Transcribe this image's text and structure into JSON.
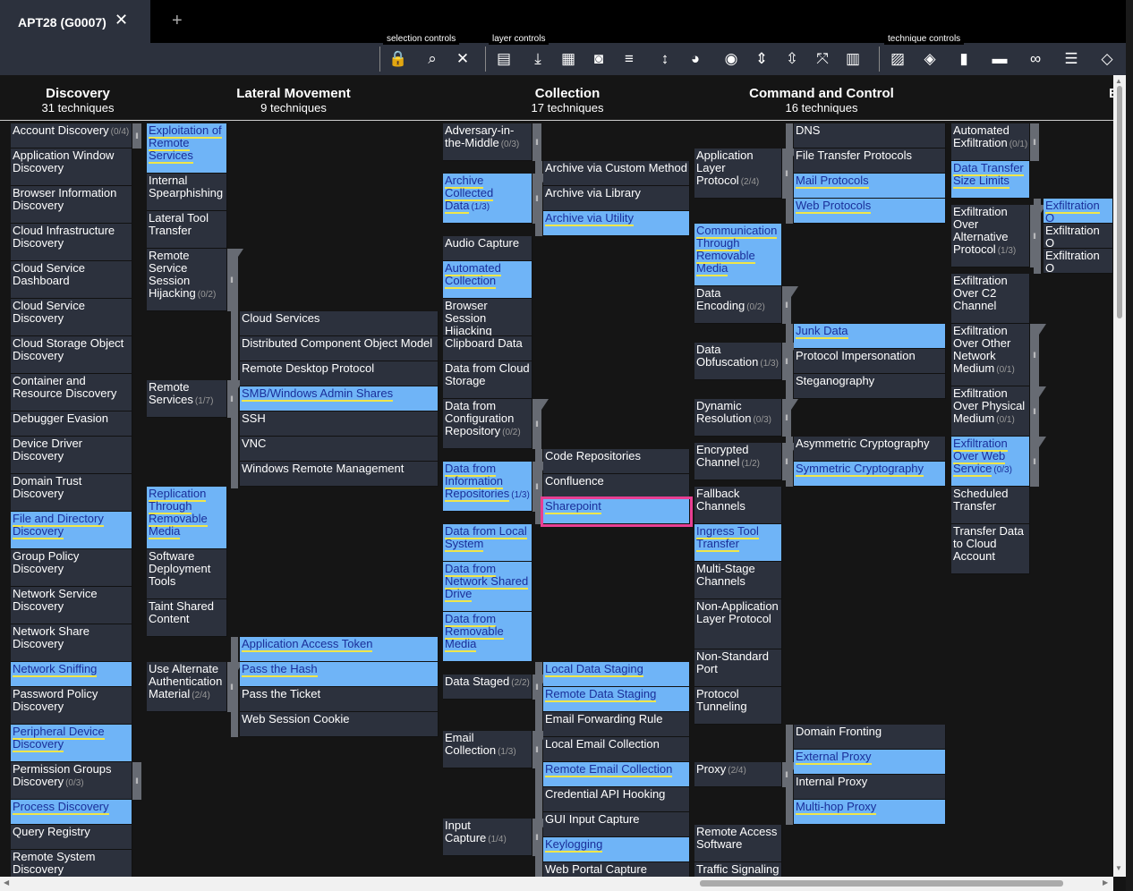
{
  "tab": {
    "title": "APT28 (G0007)",
    "close": "✕",
    "new": "+"
  },
  "toolbar": {
    "groups": [
      "selection controls",
      "layer controls",
      "technique controls"
    ],
    "icons": [
      "lock-icon",
      "search-icon",
      "clear-icon",
      "file-icon",
      "download-icon",
      "grid-icon",
      "camera-icon",
      "filter-icon",
      "sort-icon",
      "palette-icon",
      "eye-icon",
      "expand-icon",
      "expand-all-icon",
      "collapse-icon",
      "layout-icon",
      "stripes-icon",
      "fill-icon",
      "chart-icon",
      "comment-icon",
      "link-icon",
      "list-icon",
      "layers-icon"
    ]
  },
  "headers": [
    {
      "name": "Discovery",
      "count": "31 techniques"
    },
    {
      "name": "Lateral Movement",
      "count": "9 techniques"
    },
    {
      "name": "Collection",
      "count": "17 techniques"
    },
    {
      "name": "Command and Control",
      "count": "16 techniques"
    },
    {
      "name": "E",
      "count": ""
    }
  ],
  "colors": {
    "highlight": "#6fb4f7",
    "cell": "#2c313d",
    "selected_outline": "#e83f93",
    "underline": "#f0e64a"
  },
  "cells": {
    "c1": [
      {
        "t": "Account Discovery",
        "c": "(0/4)"
      },
      {
        "t": "Application Window Discovery"
      },
      {
        "t": "Browser Information Discovery"
      },
      {
        "t": "Cloud Infrastructure Discovery"
      },
      {
        "t": "Cloud Service Dashboard"
      },
      {
        "t": "Cloud Service Discovery"
      },
      {
        "t": "Cloud Storage Object Discovery"
      },
      {
        "t": "Container and Resource Discovery"
      },
      {
        "t": "Debugger Evasion"
      },
      {
        "t": "Device Driver Discovery"
      },
      {
        "t": "Domain Trust Discovery"
      },
      {
        "t": "File and Directory Discovery"
      },
      {
        "t": "Group Policy Discovery"
      },
      {
        "t": "Network Service Discovery"
      },
      {
        "t": "Network Share Discovery"
      },
      {
        "t": "Network Sniffing"
      },
      {
        "t": "Password Policy Discovery"
      },
      {
        "t": "Peripheral Device Discovery"
      },
      {
        "t": "Permission Groups Discovery",
        "c": "(0/3)"
      },
      {
        "t": "Process Discovery"
      },
      {
        "t": "Query Registry"
      },
      {
        "t": "Remote System Discovery"
      }
    ],
    "c2": [
      {
        "t": "Exploitation of Remote Services"
      },
      {
        "t": "Internal Spearphishing"
      },
      {
        "t": "Lateral Tool Transfer"
      },
      {
        "t": "Remote Service Session Hijacking",
        "c": "(0/2)"
      },
      {
        "t": "Remote Services",
        "c": "(1/7)"
      },
      {
        "t": "Replication Through Removable Media"
      },
      {
        "t": "Software Deployment Tools"
      },
      {
        "t": "Taint Shared Content"
      },
      {
        "t": "Use Alternate Authentication Material",
        "c": "(2/4)"
      }
    ],
    "c2s": [
      {
        "t": "Cloud Services"
      },
      {
        "t": "Distributed Component Object Model"
      },
      {
        "t": "Remote Desktop Protocol"
      },
      {
        "t": "SMB/Windows Admin Shares"
      },
      {
        "t": "SSH"
      },
      {
        "t": "VNC"
      },
      {
        "t": "Windows Remote Management"
      },
      {
        "t": "Application Access Token"
      },
      {
        "t": "Pass the Hash"
      },
      {
        "t": "Pass the Ticket"
      },
      {
        "t": "Web Session Cookie"
      }
    ],
    "c3": [
      {
        "t": "Adversary-in-the-Middle",
        "c": "(0/3)"
      },
      {
        "t": "Archive Collected Data",
        "c": "(1/3)"
      },
      {
        "t": "Audio Capture"
      },
      {
        "t": "Automated Collection"
      },
      {
        "t": "Browser Session Hijacking"
      },
      {
        "t": "Clipboard Data"
      },
      {
        "t": "Data from Cloud Storage"
      },
      {
        "t": "Data from Configuration Repository",
        "c": "(0/2)"
      },
      {
        "t": "Data from Information Repositories",
        "c": "(1/3)"
      },
      {
        "t": "Data from Local System"
      },
      {
        "t": "Data from Network Shared Drive"
      },
      {
        "t": "Data from Removable Media"
      },
      {
        "t": "Data Staged",
        "c": "(2/2)"
      },
      {
        "t": "Email Collection",
        "c": "(1/3)"
      },
      {
        "t": "Input Capture",
        "c": "(1/4)"
      }
    ],
    "c3s": [
      {
        "t": "Archive via Custom Method"
      },
      {
        "t": "Archive via Library"
      },
      {
        "t": "Archive via Utility"
      },
      {
        "t": "Code Repositories"
      },
      {
        "t": "Confluence"
      },
      {
        "t": "Sharepoint"
      },
      {
        "t": "Local Data Staging"
      },
      {
        "t": "Remote Data Staging"
      },
      {
        "t": "Email Forwarding Rule"
      },
      {
        "t": "Local Email Collection"
      },
      {
        "t": "Remote Email Collection"
      },
      {
        "t": "Credential API Hooking"
      },
      {
        "t": "GUI Input Capture"
      },
      {
        "t": "Keylogging"
      },
      {
        "t": "Web Portal Capture"
      }
    ],
    "c4": [
      {
        "t": "Application Layer Protocol",
        "c": "(2/4)"
      },
      {
        "t": "Communication Through Removable Media"
      },
      {
        "t": "Data Encoding",
        "c": "(0/2)"
      },
      {
        "t": "Data Obfuscation",
        "c": "(1/3)"
      },
      {
        "t": "Dynamic Resolution",
        "c": "(0/3)"
      },
      {
        "t": "Encrypted Channel",
        "c": "(1/2)"
      },
      {
        "t": "Fallback Channels"
      },
      {
        "t": "Ingress Tool Transfer"
      },
      {
        "t": "Multi-Stage Channels"
      },
      {
        "t": "Non-Application Layer Protocol"
      },
      {
        "t": "Non-Standard Port"
      },
      {
        "t": "Protocol Tunneling"
      },
      {
        "t": "Proxy",
        "c": "(2/4)"
      },
      {
        "t": "Remote Access Software"
      },
      {
        "t": "Traffic Signaling"
      }
    ],
    "c4s": [
      {
        "t": "DNS"
      },
      {
        "t": "File Transfer Protocols"
      },
      {
        "t": "Mail Protocols"
      },
      {
        "t": "Web Protocols"
      },
      {
        "t": "Junk Data"
      },
      {
        "t": "Protocol Impersonation"
      },
      {
        "t": "Steganography"
      },
      {
        "t": "Asymmetric Cryptography"
      },
      {
        "t": "Symmetric Cryptography"
      },
      {
        "t": "Domain Fronting"
      },
      {
        "t": "External Proxy"
      },
      {
        "t": "Internal Proxy"
      },
      {
        "t": "Multi-hop Proxy"
      }
    ],
    "c5": [
      {
        "t": "Automated Exfiltration",
        "c": "(0/1)"
      },
      {
        "t": "Data Transfer Size Limits"
      },
      {
        "t": "Exfiltration Over Alternative Protocol",
        "c": "(1/3)"
      },
      {
        "t": "Exfiltration Over C2 Channel"
      },
      {
        "t": "Exfiltration Over Other Network Medium",
        "c": "(0/1)"
      },
      {
        "t": "Exfiltration Over Physical Medium",
        "c": "(0/1)"
      },
      {
        "t": "Exfiltration Over Web Service",
        "c": "(0/3)"
      },
      {
        "t": "Scheduled Transfer"
      },
      {
        "t": "Transfer Data to Cloud Account"
      }
    ],
    "c5s": [
      {
        "t": "Exfiltration O"
      },
      {
        "t": "Exfiltration O"
      },
      {
        "t": "Exfiltration O"
      }
    ]
  }
}
